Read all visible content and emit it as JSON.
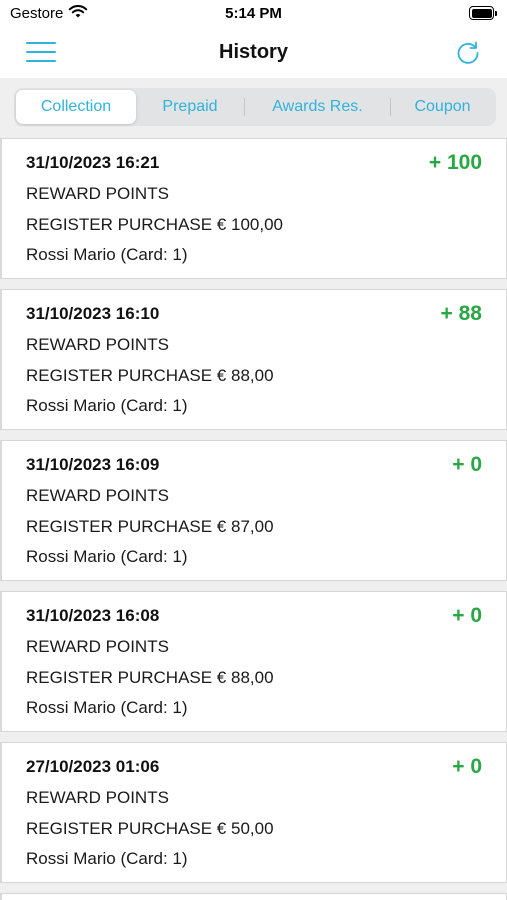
{
  "status_bar": {
    "carrier": "Gestore",
    "time": "5:14 PM"
  },
  "nav": {
    "title": "History",
    "menu_icon": "hamburger-menu-icon",
    "refresh_icon": "refresh-icon"
  },
  "tabs": [
    {
      "label": "Collection",
      "active": true
    },
    {
      "label": "Prepaid",
      "active": false
    },
    {
      "label": "Awards Res.",
      "active": false
    },
    {
      "label": "Coupon",
      "active": false
    }
  ],
  "colors": {
    "accent": "#2fb3dd",
    "points_positive": "#2aa745",
    "background": "#efefef"
  },
  "history": [
    {
      "date": "31/10/2023 16:21",
      "points": "+ 100",
      "type": "REWARD POINTS",
      "description": "REGISTER PURCHASE € 100,00",
      "customer": "Rossi Mario (Card: 1)"
    },
    {
      "date": "31/10/2023 16:10",
      "points": "+ 88",
      "type": "REWARD POINTS",
      "description": "REGISTER PURCHASE € 88,00",
      "customer": "Rossi Mario (Card: 1)"
    },
    {
      "date": "31/10/2023 16:09",
      "points": "+ 0",
      "type": "REWARD POINTS",
      "description": "REGISTER PURCHASE € 87,00",
      "customer": "Rossi Mario (Card: 1)"
    },
    {
      "date": "31/10/2023 16:08",
      "points": "+ 0",
      "type": "REWARD POINTS",
      "description": "REGISTER PURCHASE € 88,00",
      "customer": "Rossi Mario (Card: 1)"
    },
    {
      "date": "27/10/2023 01:06",
      "points": "+ 0",
      "type": "REWARD POINTS",
      "description": "REGISTER PURCHASE € 50,00",
      "customer": "Rossi Mario (Card: 1)"
    }
  ]
}
